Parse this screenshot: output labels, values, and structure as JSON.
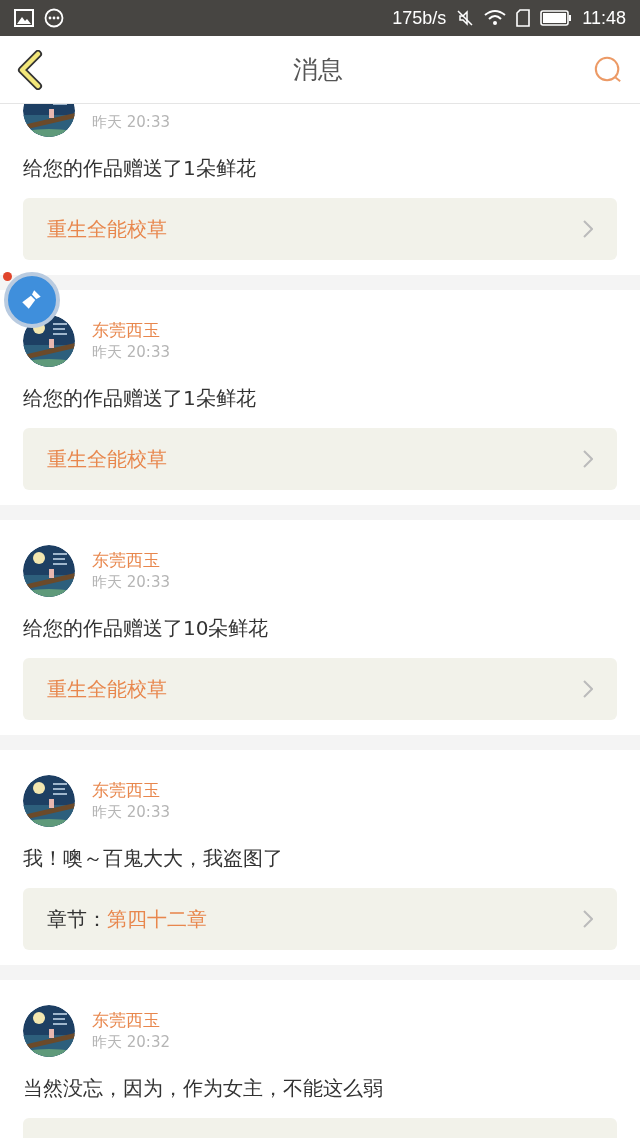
{
  "status_bar": {
    "speed": "175b/s",
    "time": "11:48"
  },
  "header": {
    "title": "消息"
  },
  "floating_badge": {
    "dot": true
  },
  "messages": [
    {
      "time": "昨天 20:33",
      "text": "给您的作品赠送了1朵鲜花",
      "link": {
        "kind": "work",
        "title": "重生全能校草"
      }
    },
    {
      "name": "东莞西玉",
      "time": "昨天 20:33",
      "text": "给您的作品赠送了1朵鲜花",
      "link": {
        "kind": "work",
        "title": "重生全能校草"
      }
    },
    {
      "name": "东莞西玉",
      "time": "昨天 20:33",
      "text": "给您的作品赠送了10朵鲜花",
      "link": {
        "kind": "work",
        "title": "重生全能校草"
      }
    },
    {
      "name": "东莞西玉",
      "time": "昨天 20:33",
      "text": "我！噢～百鬼大大，我盗图了",
      "link": {
        "kind": "chapter",
        "label": "章节：",
        "title": "第四十二章"
      }
    },
    {
      "name": "东莞西玉",
      "time": "昨天 20:32",
      "text": "当然没忘，因为，作为女主，不能这么弱",
      "link": {
        "kind": "empty"
      }
    }
  ]
}
